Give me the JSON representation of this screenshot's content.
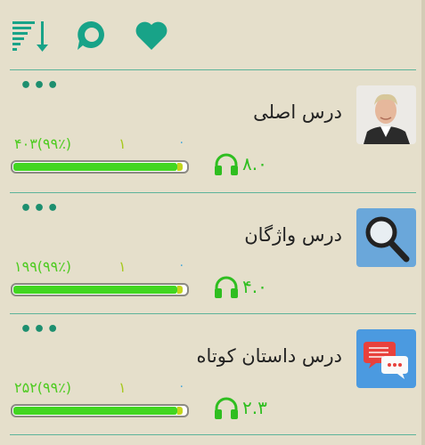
{
  "toolbar": {
    "icons": [
      "sort-icon",
      "chat-bubble-icon",
      "heart-icon"
    ],
    "accent": "#18a388"
  },
  "lessons": [
    {
      "title": "درس اصلی",
      "stat_left": "۴۰۳(۹۹٪)",
      "stat_mid": "۱",
      "stat_right": "۰",
      "progress": 0.99,
      "score": "۸.۰",
      "thumb": "person-photo",
      "more_label": "•••"
    },
    {
      "title": "درس واژگان",
      "stat_left": "۱۹۹(۹۹٪)",
      "stat_mid": "۱",
      "stat_right": "۰",
      "progress": 0.99,
      "score": "۴.۰",
      "thumb": "magnifier-icon",
      "more_label": "•••"
    },
    {
      "title": "درس داستان کوتاه",
      "stat_left": "۲۵۲(۹۹٪)",
      "stat_mid": "۱",
      "stat_right": "۰",
      "progress": 0.99,
      "score": "۲.۳",
      "thumb": "chat-bubbles-icon",
      "more_label": "•••"
    }
  ],
  "colors": {
    "background": "#e5dfcb",
    "separator": "#5cb39a",
    "progress_green": "#42d621",
    "headphones_green": "#2fbe20"
  }
}
